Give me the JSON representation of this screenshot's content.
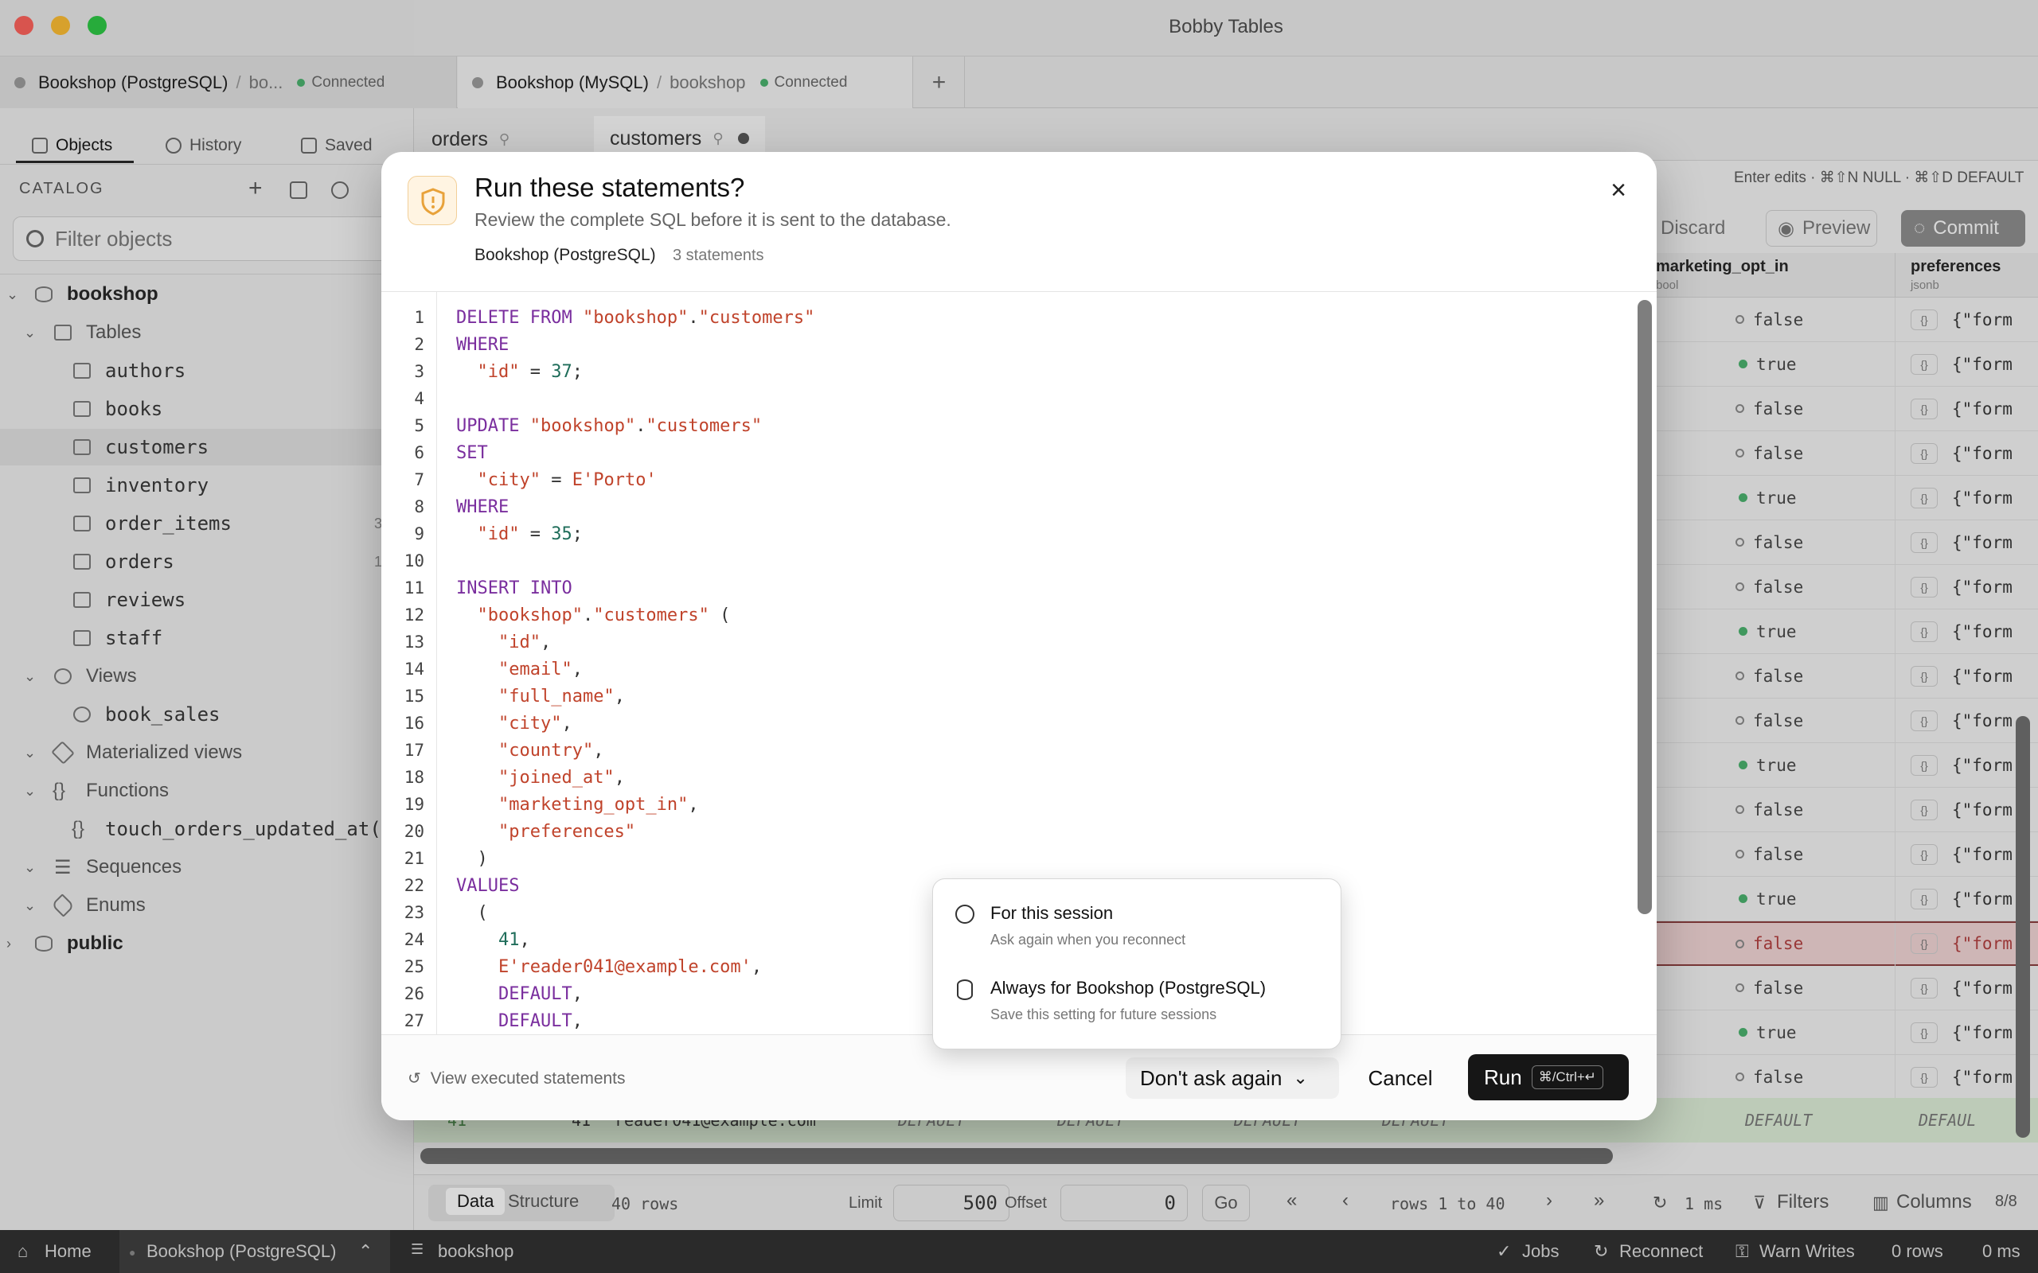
{
  "window": {
    "title": "Bobby Tables"
  },
  "connection_tabs": [
    {
      "name": "Bookshop (PostgreSQL)",
      "db": "bo...",
      "status": "Connected"
    },
    {
      "name": "Bookshop (MySQL)",
      "db": "bookshop",
      "status": "Connected"
    }
  ],
  "new_tab_symbol": "+",
  "sidebar": {
    "tabs": [
      {
        "label": "Objects"
      },
      {
        "label": "History"
      },
      {
        "label": "Saved"
      }
    ],
    "catalog_label": "CATALOG",
    "filter_placeholder": "Filter objects",
    "tree": {
      "schema": "bookshop",
      "tables_label": "Tables",
      "tables": [
        "authors",
        "books",
        "customers",
        "inventory",
        "order_items",
        "orders",
        "reviews",
        "staff"
      ],
      "table_counts": {
        "order_items": "3",
        "orders": "1"
      },
      "views_label": "Views",
      "views": [
        "book_sales"
      ],
      "materialized_label": "Materialized views",
      "functions_label": "Functions",
      "functions": [
        "touch_orders_updated_at()"
      ],
      "sequences_label": "Sequences",
      "enums_label": "Enums",
      "public": "public"
    }
  },
  "editor_tabs": [
    {
      "label": "orders"
    },
    {
      "label": "customers"
    }
  ],
  "grid": {
    "hint": "Enter edits · ⌘⇧N NULL · ⌘⇧D DEFAULT",
    "discard_label": "Discard",
    "preview_label": "Preview",
    "commit_label": "Commit",
    "col1": {
      "name": "marketing_opt_in",
      "type": "bool"
    },
    "col2": {
      "name": "preferences",
      "type": "jsonb"
    },
    "rows": [
      "false",
      "true",
      "false",
      "false",
      "true",
      "false",
      "false",
      "true",
      "false",
      "false",
      "true",
      "false",
      "false",
      "true",
      "false",
      "false",
      "true",
      "false"
    ],
    "json_badge": "{}",
    "json_preview": "{\"form",
    "new_row": {
      "num": "41",
      "id": "41",
      "email": "reader041@example.com",
      "default": "DEFAULT",
      "json": "DEFAUL"
    }
  },
  "bottom_bar": {
    "data_tab": "Data",
    "structure_tab": "Structure",
    "row_count": "40 rows",
    "limit_label": "Limit",
    "limit_value": "500",
    "offset_label": "Offset",
    "offset_value": "0",
    "go_label": "Go",
    "rows_range": "rows 1 to 40",
    "timing": "1 ms",
    "filters_label": "Filters",
    "columns_label": "Columns",
    "columns_count": "8/8"
  },
  "statusbar": {
    "home": "Home",
    "connection": "Bookshop (PostgreSQL)",
    "database": "bookshop",
    "jobs": "Jobs",
    "reconnect": "Reconnect",
    "warn_writes": "Warn Writes",
    "rows": "0 rows",
    "time": "0 ms"
  },
  "dialog": {
    "title": "Run these statements?",
    "subtitle": "Review the complete SQL before it is sent to the database.",
    "connection": "Bookshop (PostgreSQL)",
    "statement_count": "3 statements",
    "view_executed": "View executed statements",
    "dont_ask_label": "Don't ask again",
    "cancel_label": "Cancel",
    "run_label": "Run",
    "run_shortcut": "⌘/Ctrl+↵",
    "code_lines": [
      "DELETE FROM \"bookshop\".\"customers\"",
      "WHERE",
      "  \"id\" = 37;",
      "",
      "UPDATE \"bookshop\".\"customers\"",
      "SET",
      "  \"city\" = E'Porto'",
      "WHERE",
      "  \"id\" = 35;",
      "",
      "INSERT INTO",
      "  \"bookshop\".\"customers\" (",
      "    \"id\",",
      "    \"email\",",
      "    \"full_name\",",
      "    \"city\",",
      "    \"country\",",
      "    \"joined_at\",",
      "    \"marketing_opt_in\",",
      "    \"preferences\"",
      "  )",
      "VALUES",
      "  (",
      "    41,",
      "    E'reader041@example.com',",
      "    DEFAULT,",
      "    DEFAULT,"
    ]
  },
  "popover": {
    "options": [
      {
        "title": "For this session",
        "subtitle": "Ask again when you reconnect"
      },
      {
        "title": "Always for Bookshop (PostgreSQL)",
        "subtitle": "Save this setting for future sessions"
      }
    ]
  },
  "colors": {
    "accent_green": "#46b16b",
    "run_button": "#161616",
    "warning_icon": "#e8a23a"
  }
}
